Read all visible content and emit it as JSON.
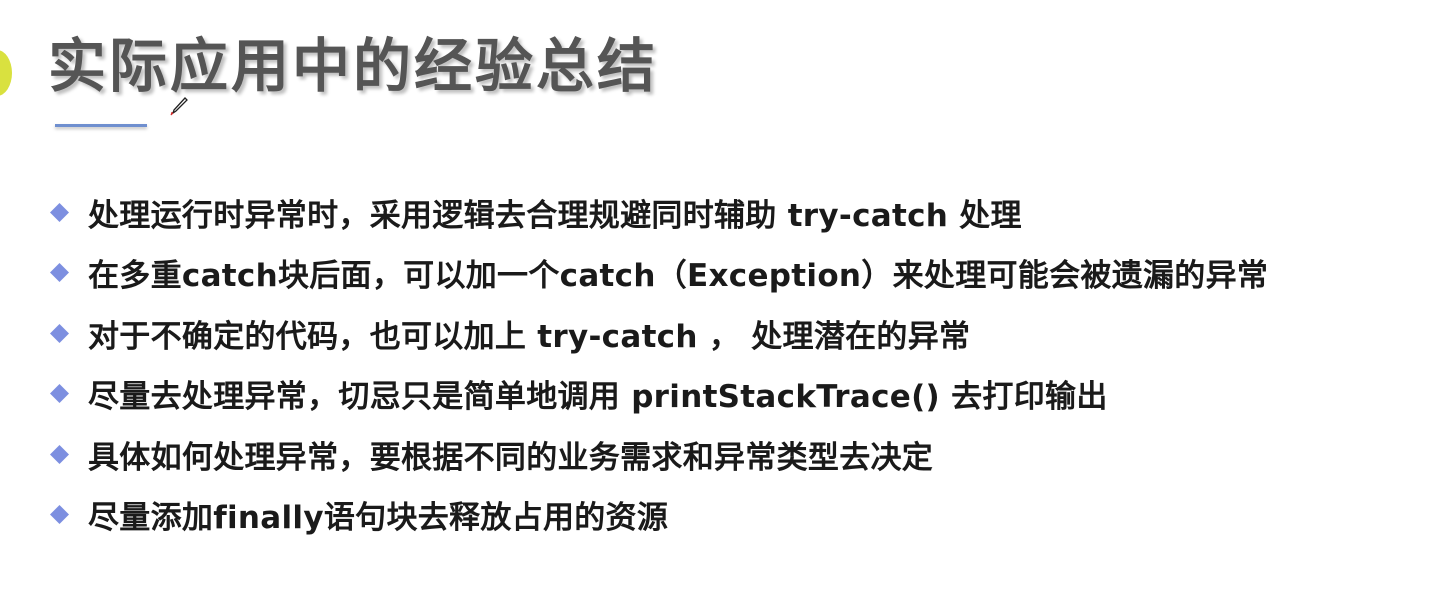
{
  "slide": {
    "title": "实际应用中的经验总结",
    "accent_color": "#6f8fcf",
    "bullet_color": "#7d8fe0",
    "bullet_icon": "diamond-bullet-icon",
    "bullets": [
      "处理运行时异常时，采用逻辑去合理规避同时辅助 try-catch 处理",
      "在多重catch块后面，可以加一个catch（Exception）来处理可能会被遗漏的异常",
      "对于不确定的代码，也可以加上 try-catch ， 处理潜在的异常",
      "尽量去处理异常，切忌只是简单地调用 printStackTrace() 去打印输出",
      "具体如何处理异常，要根据不同的业务需求和异常类型去决定",
      "尽量添加finally语句块去释放占用的资源"
    ]
  }
}
